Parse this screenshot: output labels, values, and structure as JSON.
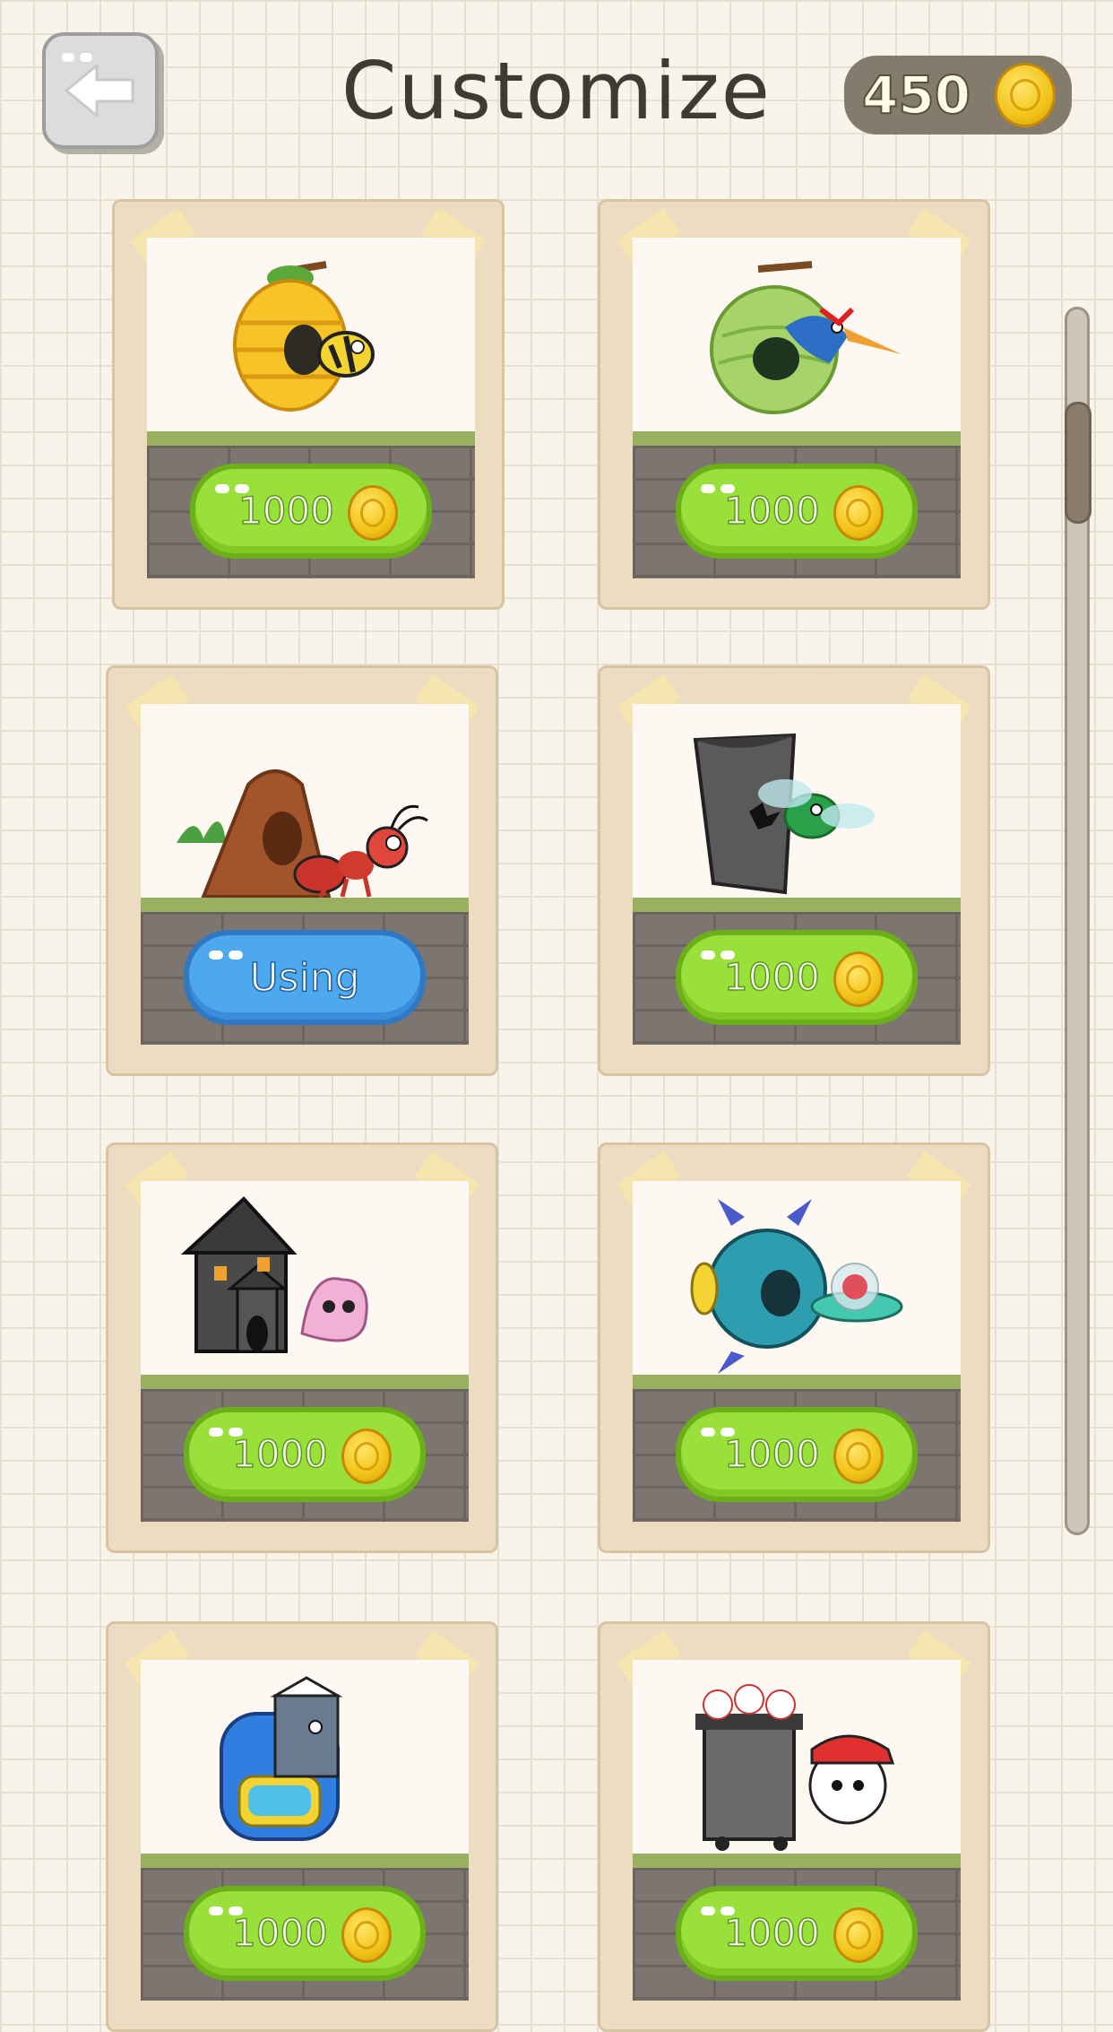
{
  "header": {
    "title": "Customize",
    "coins": "450",
    "back_icon": "arrow-left-icon"
  },
  "items": [
    {
      "name": "beehive-bee",
      "status": "price",
      "price": "1000"
    },
    {
      "name": "leaf-nest-bird",
      "status": "price",
      "price": "1000"
    },
    {
      "name": "rock-cave-ant",
      "status": "using",
      "label": "Using"
    },
    {
      "name": "trash-bag-fly",
      "status": "price",
      "price": "1000"
    },
    {
      "name": "haunted-house-ghost",
      "status": "price",
      "price": "1000"
    },
    {
      "name": "spaceship-alien",
      "status": "price",
      "price": "1000"
    },
    {
      "name": "backpack-milk",
      "status": "price",
      "price": "1000"
    },
    {
      "name": "baseball-bin",
      "status": "price",
      "price": "1000"
    }
  ],
  "colors": {
    "price_button": "#9ae03a",
    "using_button": "#4ea8ee",
    "coin": "#f2c318"
  }
}
